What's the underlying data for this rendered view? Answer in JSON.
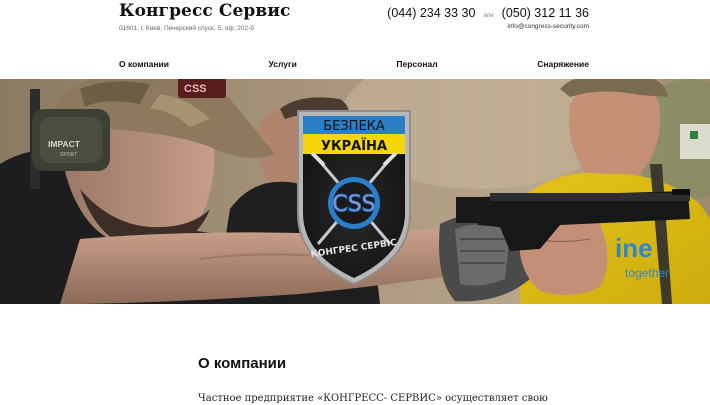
{
  "header": {
    "brand": "Конгресс Сервис",
    "address": "01601, г. Киев, Печерский спуск, 5, оф. 202-б",
    "phone1": "(044) 234 33 30",
    "or_label": "или",
    "phone2": "(050) 312 11 36",
    "email": "info@congress-security.com"
  },
  "nav": {
    "items": [
      {
        "label": "О компании"
      },
      {
        "label": "Услуги"
      },
      {
        "label": "Персонал"
      },
      {
        "label": "Снаряжение"
      }
    ]
  },
  "hero": {
    "emblem_top": "БЕЗПЕКА",
    "emblem_middle": "УКРАЇНА",
    "emblem_logo": "CSS",
    "emblem_bottom": "КОНГРЕС СЕРВІС",
    "cap_badge": "CSS",
    "earmuff_brand": "IMPACT",
    "earmuff_sub": "SPORT",
    "shirt_text1": "ine",
    "shirt_text2": "together"
  },
  "content": {
    "title": "О компании",
    "text": "Частное предприятие «КОНГРЕСС- СЕРВИС» осуществляет свою"
  },
  "colors": {
    "text": "#111111",
    "muted": "#666666",
    "shield_dark": "#1d1d1f",
    "shield_blue": "#2a7fc8",
    "shield_yellow": "#f4d60a"
  }
}
